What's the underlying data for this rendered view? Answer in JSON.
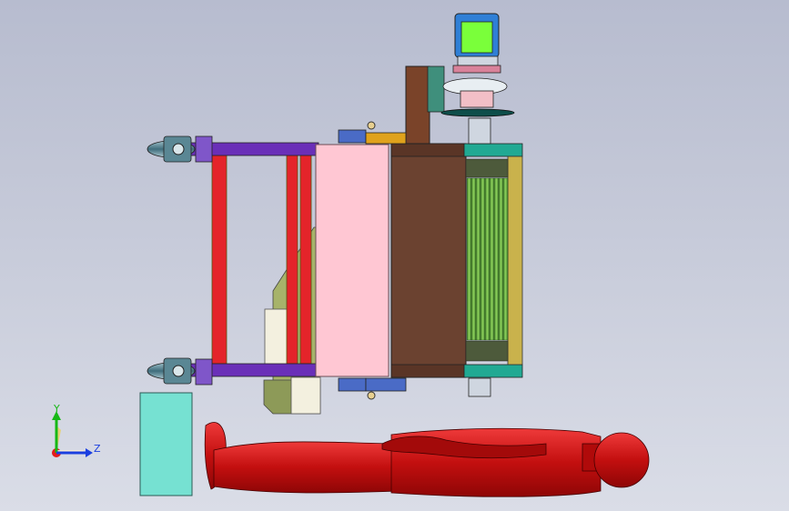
{
  "viewport": {
    "triad": {
      "y_label": "Y",
      "z_label": "Z"
    }
  },
  "colors": {
    "background_top": "#b7bccf",
    "background_bottom": "#dadde7",
    "frame_red": "#e4242a",
    "frame_purple": "#6a2fb8",
    "panel_pink": "#ffc7d3",
    "body_brown": "#6b4230",
    "rollers_green": "#6fb24a",
    "rollers_frame_yellow": "#c9b24c",
    "teal_bar": "#21a993",
    "motor_green": "#7aff3a",
    "motor_blue": "#2f7fd6",
    "wedge_olive": "#a7b36a",
    "block_cream": "#f3f0df",
    "box_cyan": "#76e1d2",
    "mannequin_red": "#c40c0c",
    "caster_steel": "#58808f",
    "bracket_blue": "#4a6bc6",
    "bracket_orange": "#e0a21c"
  },
  "scene": {
    "parts": [
      "caster-top",
      "caster-bottom",
      "side-frame",
      "pink-panel",
      "brown-housing",
      "roller-bank",
      "motor-assembly",
      "olive-wedge",
      "cyan-box",
      "mannequin"
    ]
  }
}
